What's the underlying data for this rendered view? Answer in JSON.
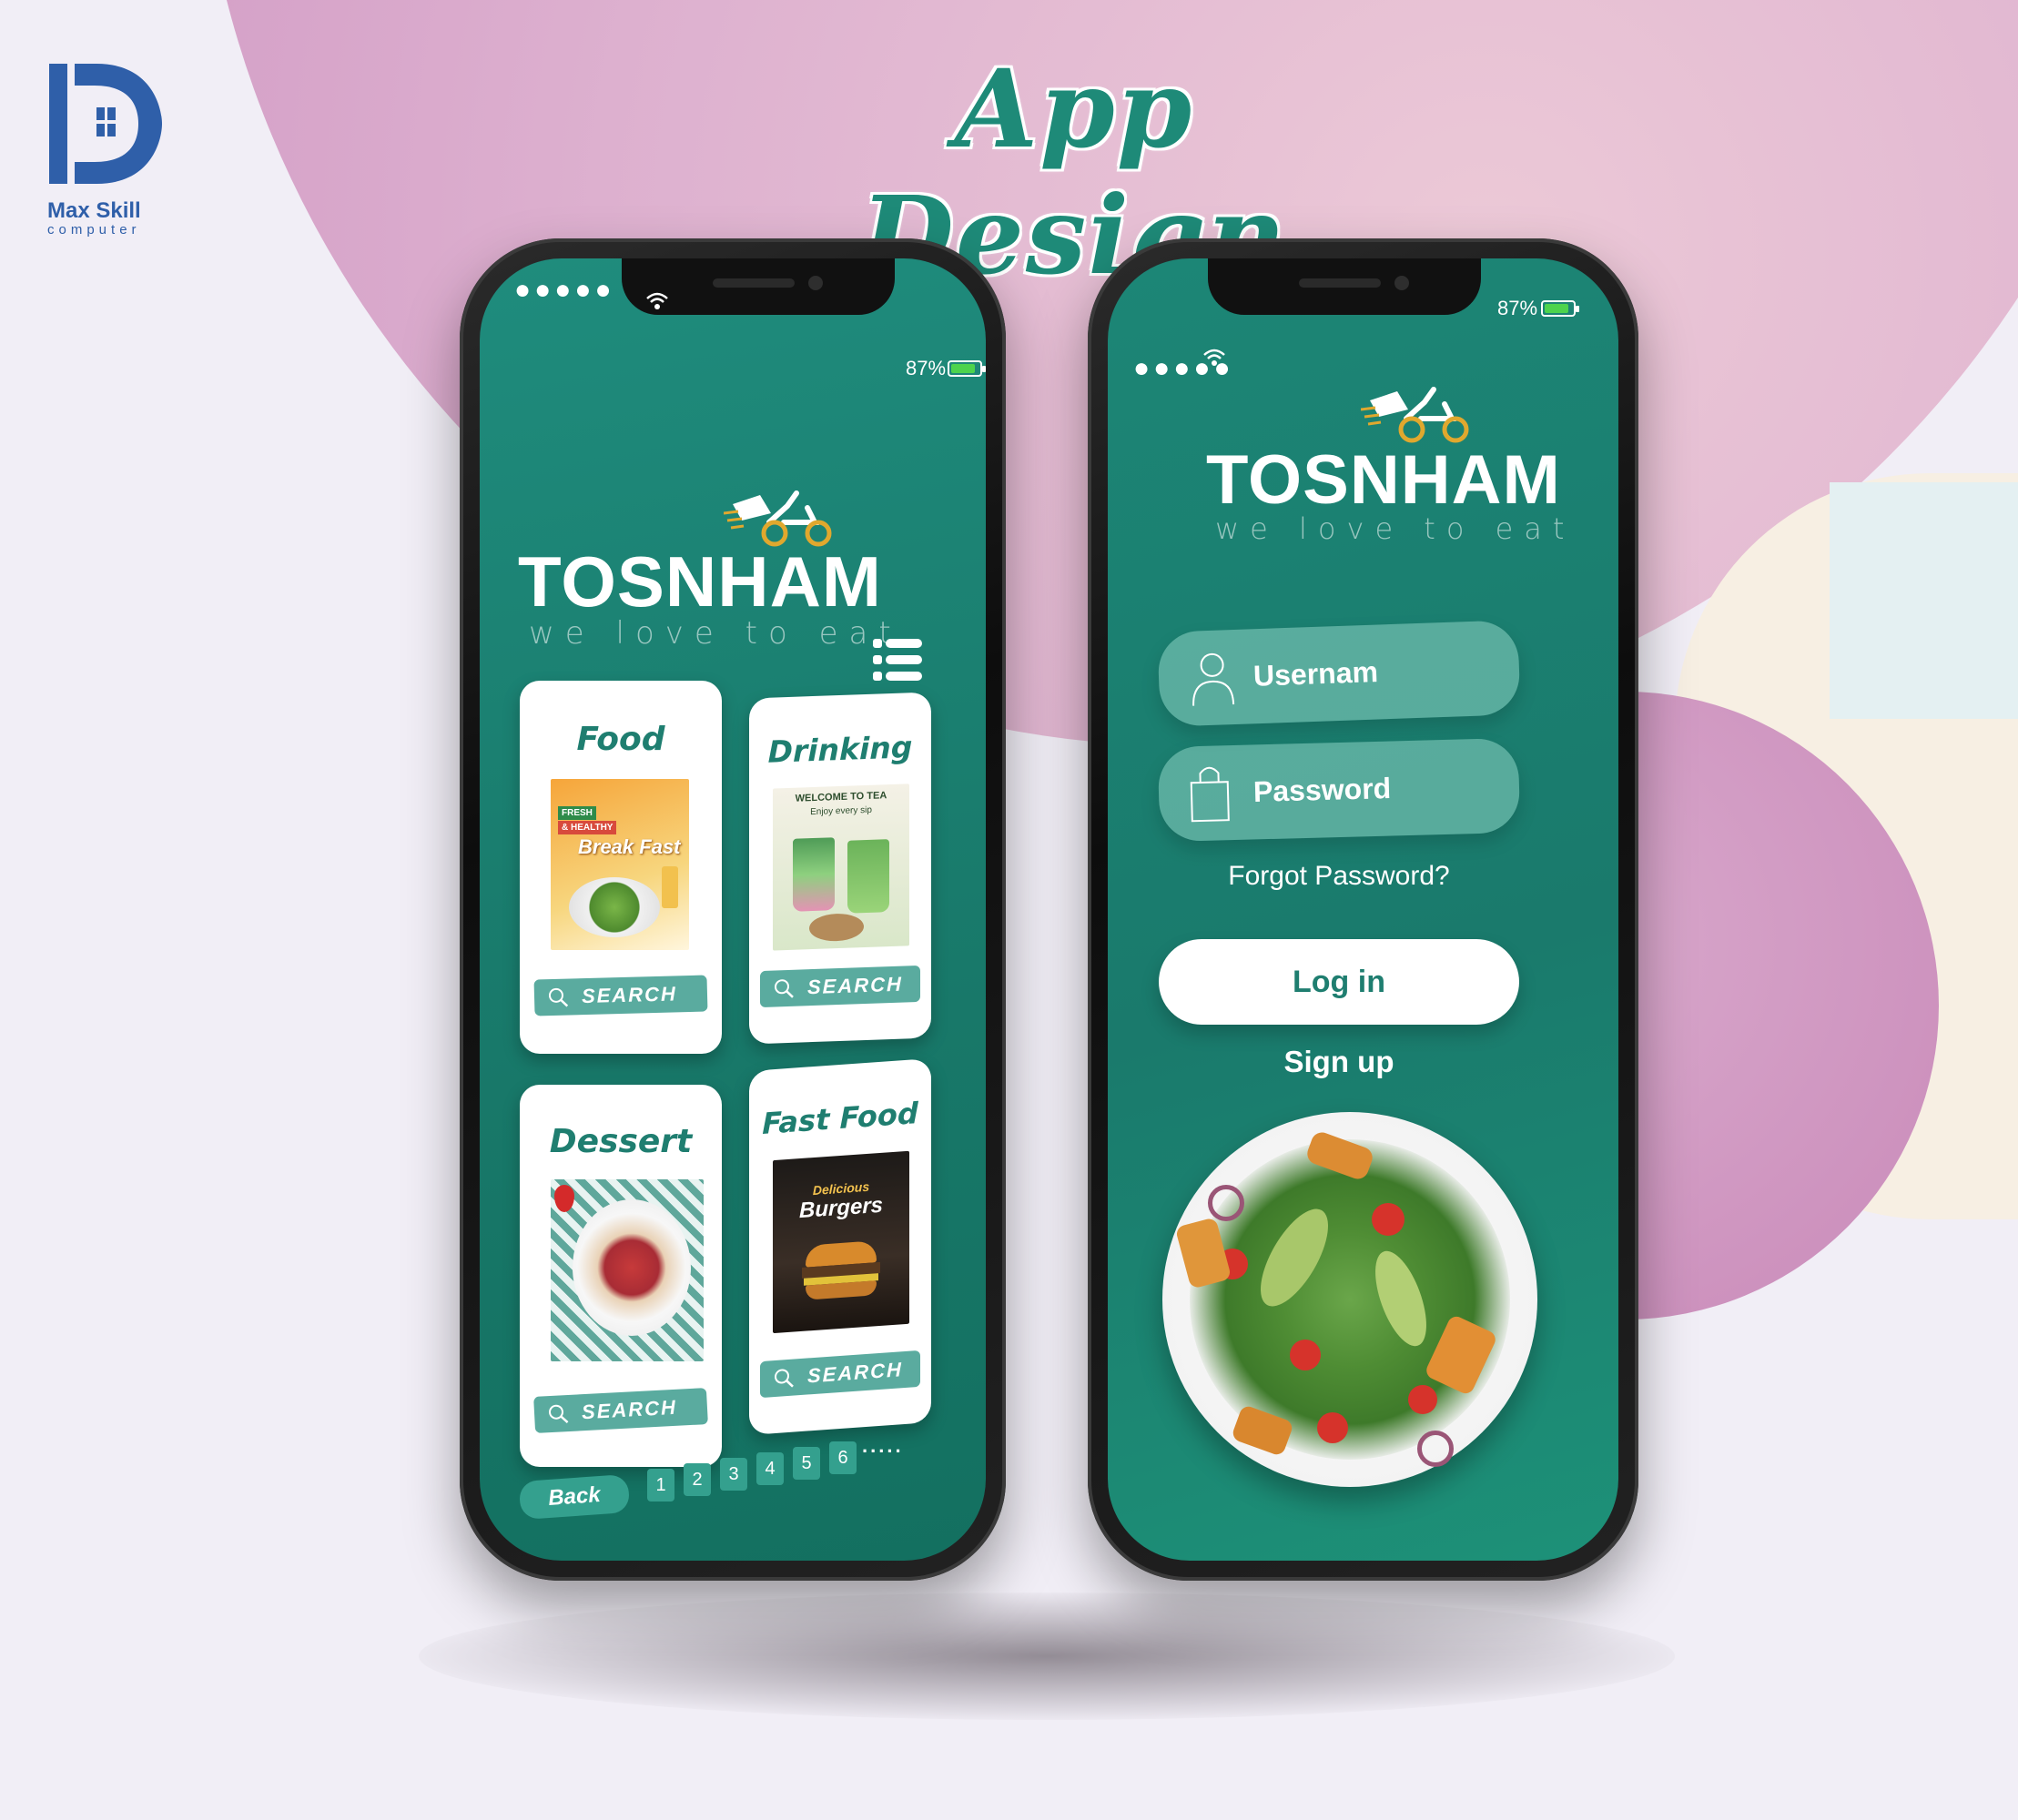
{
  "page": {
    "title": "App Design"
  },
  "brand": {
    "name": "Max Skill",
    "sub": "computer",
    "accent": "#2f5fa9"
  },
  "colors": {
    "screen": "#1a8070",
    "accent": "#1f7e70",
    "button": "#5aab9f",
    "battery": "#4dd34d"
  },
  "left_phone": {
    "status": {
      "battery": "87%"
    },
    "app": {
      "name": "TOSNHAM",
      "tagline": "we love to eat"
    },
    "menu_icon": "list-menu-icon",
    "categories": [
      {
        "title": "Food",
        "button": "SEARCH"
      },
      {
        "title": "Drinking",
        "button": "SEARCH"
      },
      {
        "title": "Dessert",
        "button": "SEARCH"
      },
      {
        "title": "Fast Food",
        "button": "SEARCH"
      }
    ],
    "pager": {
      "back": "Back",
      "pages": [
        "1",
        "2",
        "3",
        "4",
        "5",
        "6"
      ],
      "more": "....."
    },
    "images": {
      "food": {
        "badge1": "FRESH",
        "badge2": "& HEALTHY",
        "text": "Break Fast"
      },
      "drink": {
        "text1": "WELCOME TO TEA",
        "text2": "Enjoy every sip"
      },
      "fastfood": {
        "text1": "Delicious",
        "text2": "Burgers"
      }
    }
  },
  "right_phone": {
    "status": {
      "battery": "87%"
    },
    "app": {
      "name": "TOSNHAM",
      "tagline": "we love to eat"
    },
    "username_placeholder": "Usernam",
    "password_placeholder": "Password",
    "forgot": "Forgot Password?",
    "login": "Log in",
    "signup": "Sign up"
  }
}
